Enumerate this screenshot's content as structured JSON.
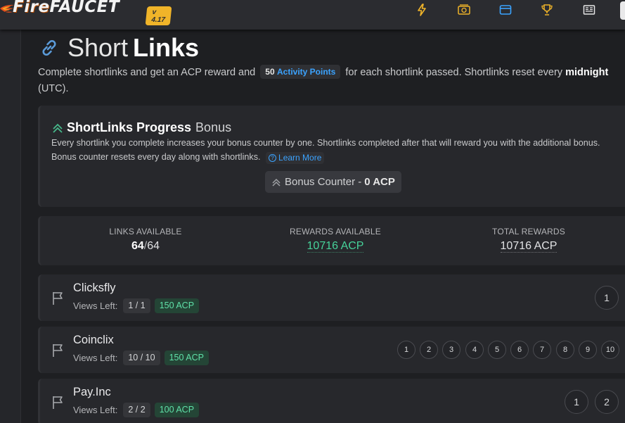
{
  "app": {
    "logo_fire": "Fire",
    "logo_faucet": "FAUCET",
    "version": "v 4.17"
  },
  "nav": {
    "icons": [
      "lightning-icon",
      "money-icon",
      "window-icon",
      "trophy-icon",
      "news-icon"
    ],
    "accent": "#f0b429"
  },
  "page": {
    "title_light": "Short",
    "title_bold": "Links",
    "desc_pre": "Complete shortlinks and get an ACP reward and",
    "ap_amount": "50",
    "ap_label": "Activity Points",
    "desc_post": "for each shortlink passed. Shortlinks reset every",
    "desc_bold": "midnight",
    "desc_tail": "(UTC)."
  },
  "bonus": {
    "title_bold": "ShortLinks Progress",
    "title_light": "Bonus",
    "text": "Every shortlink you complete increases your bonus counter by one. Shortlinks completed after that will reward you with the additional bonus. Bonus counter resets every day along with shortlinks.",
    "learn_more": "Learn More",
    "counter_label": "Bonus Counter -",
    "counter_value": "0 ACP"
  },
  "stats": {
    "links_label": "LINKS AVAILABLE",
    "links_current": "64",
    "links_sep": "/",
    "links_total": "64",
    "rewards_label": "REWARDS AVAILABLE",
    "rewards_value": "10716 ACP",
    "total_label": "TOTAL REWARDS",
    "total_value": "10716 ACP"
  },
  "links": [
    {
      "name": "Clicksfly",
      "views_label": "Views Left:",
      "views": "1 / 1",
      "reward": "150 ACP",
      "buttons": [
        "1"
      ]
    },
    {
      "name": "Coinclix",
      "views_label": "Views Left:",
      "views": "10 / 10",
      "reward": "150 ACP",
      "buttons": [
        "1",
        "2",
        "3",
        "4",
        "5",
        "6",
        "7",
        "8",
        "9",
        "10"
      ]
    },
    {
      "name": "Pay.Inc",
      "views_label": "Views Left:",
      "views": "2 / 2",
      "reward": "100 ACP",
      "buttons": [
        "1",
        "2"
      ]
    }
  ],
  "colors": {
    "background": "#1e1f22",
    "card": "#27282c",
    "green": "#46d29a",
    "blue": "#3ba3ff"
  }
}
